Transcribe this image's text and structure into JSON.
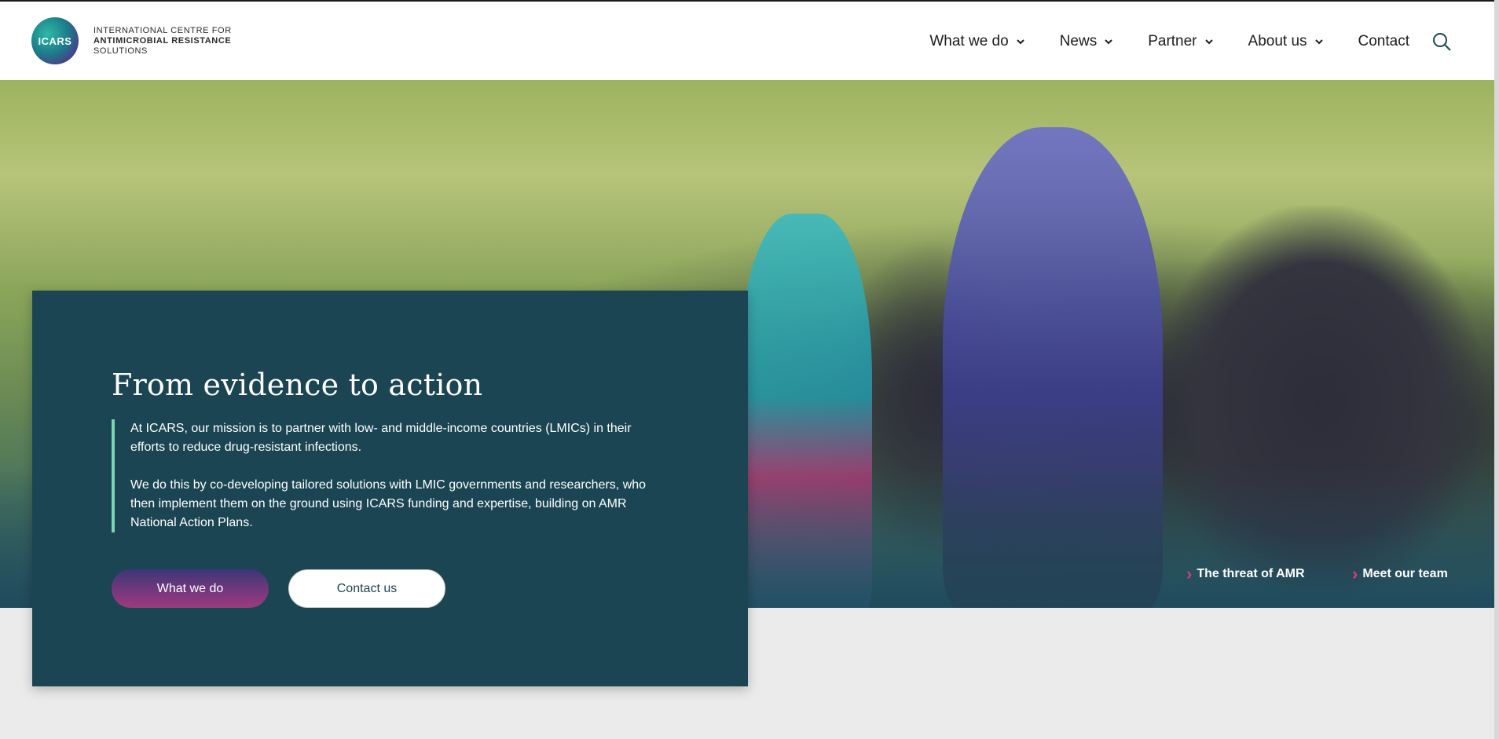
{
  "brand": {
    "logo_mark": "ICARS",
    "line1": "INTERNATIONAL CENTRE FOR",
    "line2": "ANTIMICROBIAL RESISTANCE",
    "line3": "SOLUTIONS"
  },
  "nav": {
    "items": [
      {
        "label": "What we do"
      },
      {
        "label": "News"
      },
      {
        "label": "Partner"
      },
      {
        "label": "About us"
      },
      {
        "label": "Contact"
      }
    ],
    "search_icon": "search-icon"
  },
  "hero": {
    "links": [
      {
        "label": "The threat of AMR"
      },
      {
        "label": "Meet our team"
      }
    ]
  },
  "card": {
    "title": "From evidence to action",
    "paragraph1": "At ICARS, our mission is to partner with low- and middle-income countries (LMICs) in their efforts to reduce drug-resistant infections.",
    "paragraph2": "We do this by co-developing tailored solutions with LMIC governments and researchers, who then implement them on the ground using ICARS funding and expertise, building on AMR National Action Plans.",
    "primary_button": "What we do",
    "secondary_button": "Contact us"
  },
  "colors": {
    "card_bg": "#1b4553",
    "accent_border": "#7ed3b2",
    "link_arrow": "#d63a86"
  }
}
